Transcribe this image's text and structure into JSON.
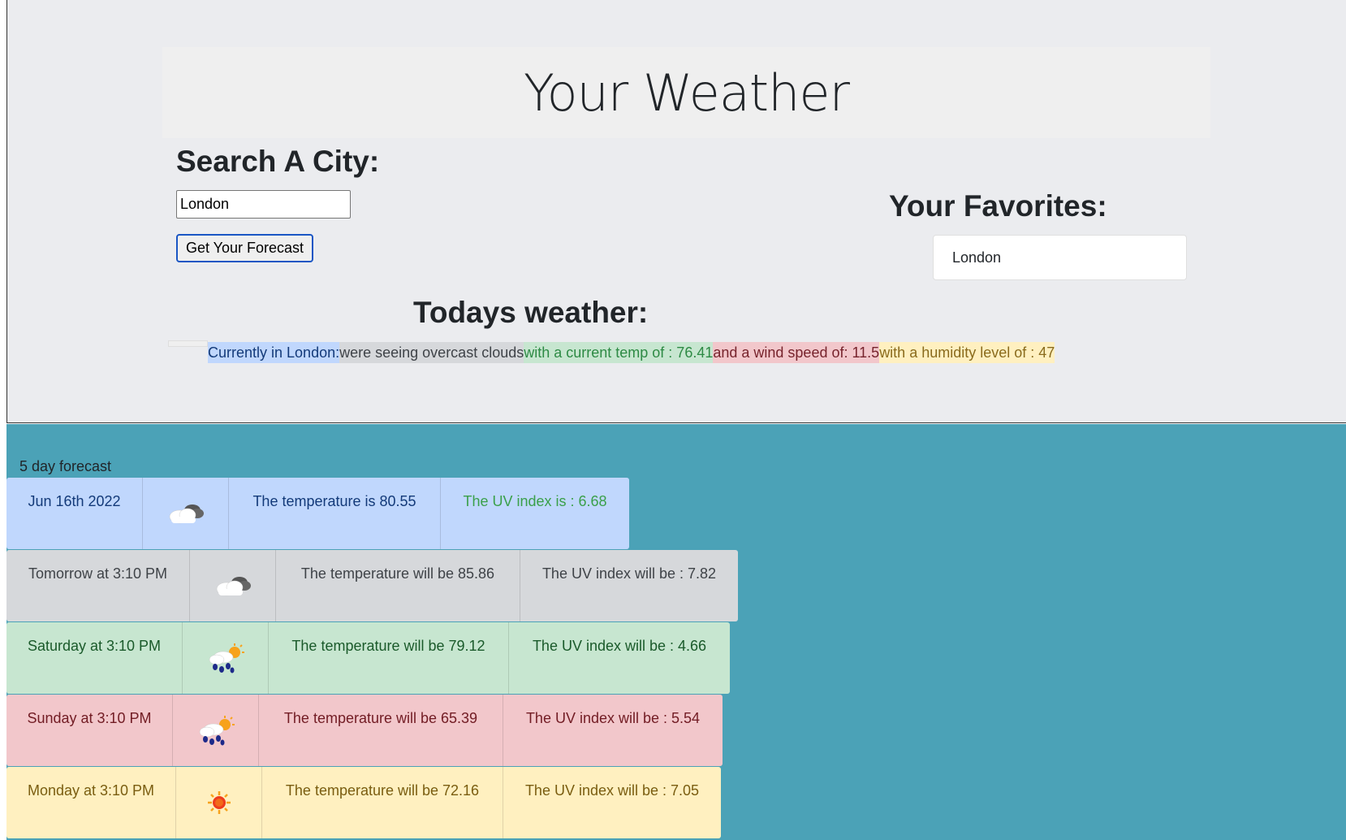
{
  "header": {
    "title": "Your Weather"
  },
  "search": {
    "heading": "Search A City:",
    "input_value": "London",
    "button_label": "Get Your Forecast"
  },
  "favorites": {
    "heading": "Your Favorites:",
    "items": [
      "London"
    ]
  },
  "today": {
    "heading": "Todays weather:",
    "location": "Currently in London:",
    "conditions": "were seeing overcast clouds",
    "temperature": "with a current temp of : 76.41",
    "wind": "and a wind speed of: 11.5",
    "humidity": "with a humidity level of : 47"
  },
  "forecast": {
    "label": "5 day forecast",
    "days": [
      {
        "date": "Jun 16th 2022",
        "icon": "cloud-icon",
        "temperature": "The temperature is 80.55",
        "uv": "The UV index is : 6.68",
        "color": "#c0d7fd"
      },
      {
        "date": "Tomorrow at 3:10 PM",
        "icon": "cloud-icon",
        "temperature": "The temperature will be 85.86",
        "uv": "The UV index will be : 7.82",
        "color": "#d6d8db"
      },
      {
        "date": "Saturday at 3:10 PM",
        "icon": "rain-sun-icon",
        "temperature": "The temperature will be 79.12",
        "uv": "The UV index will be : 4.66",
        "color": "#c7e6d0"
      },
      {
        "date": "Sunday at 3:10 PM",
        "icon": "rain-sun-icon",
        "temperature": "The temperature will be 65.39",
        "uv": "The UV index will be : 5.54",
        "color": "#f2c7cb"
      },
      {
        "date": "Monday at 3:10 PM",
        "icon": "sun-icon",
        "temperature": "The temperature will be 72.16",
        "uv": "The UV index will be : 7.05",
        "color": "#fff0c0"
      }
    ]
  },
  "colors": {
    "top_background": "#ebecef",
    "bottom_background": "#4ba2b7",
    "button_border": "#1a56c4"
  }
}
